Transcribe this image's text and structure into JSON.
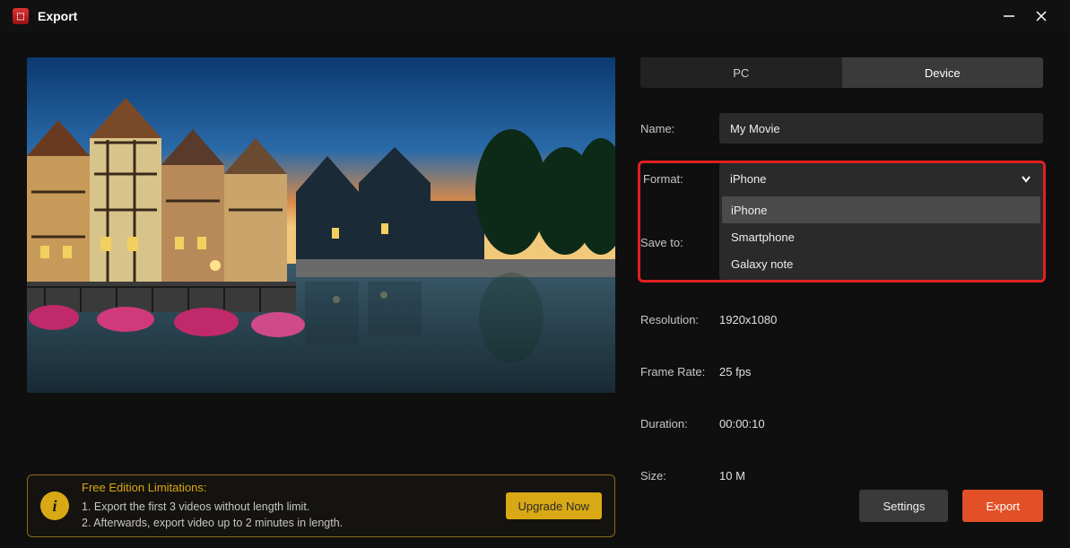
{
  "window": {
    "title": "Export"
  },
  "tabs": {
    "pc": "PC",
    "device": "Device"
  },
  "fields": {
    "name": {
      "label": "Name:",
      "value": "My Movie"
    },
    "format": {
      "label": "Format:",
      "value": "iPhone",
      "options": [
        "iPhone",
        "Smartphone",
        "Galaxy note"
      ]
    },
    "save_to": {
      "label": "Save to:"
    },
    "resolution": {
      "label": "Resolution:",
      "value": "1920x1080"
    },
    "frame_rate": {
      "label": "Frame Rate:",
      "value": "25 fps"
    },
    "duration": {
      "label": "Duration:",
      "value": "00:00:10"
    },
    "size": {
      "label": "Size:",
      "value": "10 M"
    }
  },
  "promo": {
    "title": "Free Edition Limitations:",
    "line1": "1. Export the first 3 videos without length limit.",
    "line2": "2. Afterwards, export video up to 2 minutes in length.",
    "button": "Upgrade Now"
  },
  "buttons": {
    "settings": "Settings",
    "export": "Export"
  }
}
